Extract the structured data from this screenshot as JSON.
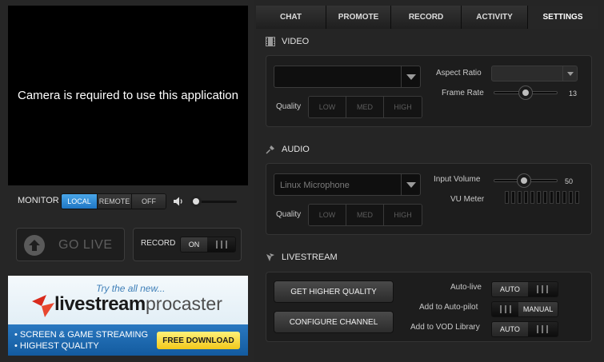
{
  "preview": {
    "message": "Camera is required to use this application"
  },
  "monitor": {
    "label": "MONITOR",
    "options": [
      "LOCAL",
      "REMOTE",
      "OFF"
    ],
    "selected": "LOCAL"
  },
  "golive": {
    "label": "GO LIVE"
  },
  "record": {
    "label": "RECORD",
    "toggle": "ON"
  },
  "ad": {
    "tagline": "Try the all new...",
    "brand": "livestream",
    "product": "procaster",
    "features": [
      "• SCREEN & GAME STREAMING",
      "• HIGHEST QUALITY"
    ],
    "cta": "FREE DOWNLOAD"
  },
  "tabs": [
    {
      "label": "CHAT"
    },
    {
      "label": "PROMOTE"
    },
    {
      "label": "RECORD"
    },
    {
      "label": "ACTIVITY"
    },
    {
      "label": "SETTINGS",
      "active": true
    }
  ],
  "video": {
    "title": "VIDEO",
    "camera_select": "",
    "quality_label": "Quality",
    "quality_options": [
      "LOW",
      "MED",
      "HIGH"
    ],
    "aspect_label": "Aspect Ratio",
    "aspect_value": "",
    "framerate_label": "Frame Rate",
    "framerate_value": "13"
  },
  "audio": {
    "title": "AUDIO",
    "mic_select": "Linux Microphone",
    "quality_label": "Quality",
    "quality_options": [
      "LOW",
      "MED",
      "HIGH"
    ],
    "input_volume_label": "Input Volume",
    "input_volume_value": "50",
    "vu_label": "VU Meter"
  },
  "livestream": {
    "title": "LIVESTREAM",
    "btn_quality": "GET HIGHER QUALITY",
    "btn_configure": "CONFIGURE CHANNEL",
    "autolive_label": "Auto-live",
    "autolive_value": "AUTO",
    "autopilot_label": "Add to Auto-pilot",
    "autopilot_value": "MANUAL",
    "vod_label": "Add to VOD Library",
    "vod_value": "AUTO"
  }
}
